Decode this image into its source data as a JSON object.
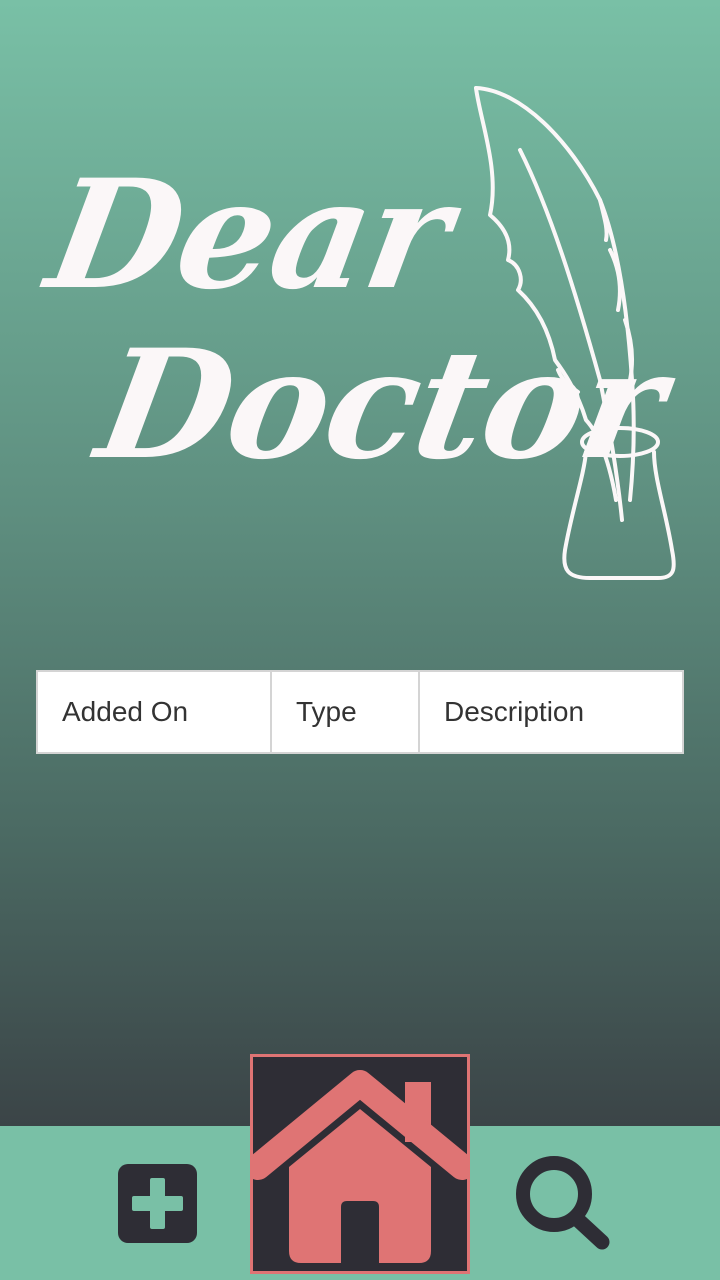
{
  "logo": {
    "line1": "Dear",
    "line2": "Doctor",
    "icon": "quill-inkwell-icon"
  },
  "table": {
    "headers": [
      "Added On",
      "Type",
      "Description"
    ]
  },
  "nav": {
    "add_icon": "plus-square-icon",
    "home_icon": "home-icon",
    "search_icon": "search-icon",
    "active": "home"
  },
  "colors": {
    "accent": "#79c0a6",
    "dark": "#2e2d35",
    "home_active": "#df7474",
    "logo_text": "#fbf7f8"
  }
}
